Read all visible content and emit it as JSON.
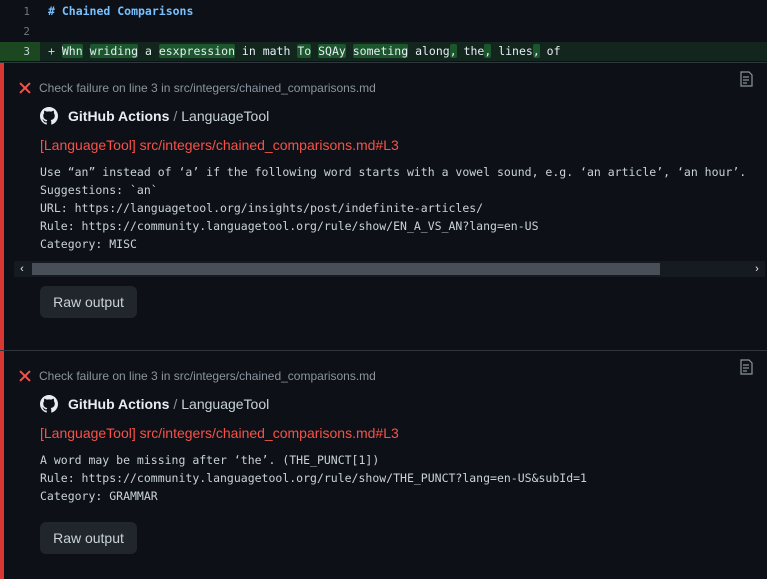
{
  "diff": {
    "lines": [
      {
        "num": "1",
        "text": "# Chained Comparisons"
      },
      {
        "num": "2",
        "text": ""
      },
      {
        "num": "3",
        "prefix": "+ ",
        "segments": [
          {
            "t": "Whn",
            "hl": true
          },
          {
            "t": " "
          },
          {
            "t": "wriding",
            "hl": true
          },
          {
            "t": " a "
          },
          {
            "t": "esxpression",
            "hl": true
          },
          {
            "t": " in math "
          },
          {
            "t": "To",
            "hl": true
          },
          {
            "t": " "
          },
          {
            "t": "SQAy",
            "hl": true
          },
          {
            "t": " "
          },
          {
            "t": "someting",
            "hl": true
          },
          {
            "t": " along"
          },
          {
            "t": ",",
            "hl": true
          },
          {
            "t": " the"
          },
          {
            "t": ",",
            "hl": true
          },
          {
            "t": " lines"
          },
          {
            "t": ",",
            "hl": true
          },
          {
            "t": " of"
          }
        ]
      }
    ]
  },
  "annotations": [
    {
      "header": "Check failure on line 3 in src/integers/chained_comparisons.md",
      "source_app": "GitHub Actions",
      "source_sep": "/",
      "source_tool": "LanguageTool",
      "title": "[LanguageTool] src/integers/chained_comparisons.md#L3",
      "message": "Use “an” instead of ‘a’ if the following word starts with a vowel sound, e.g. ‘an article’, ‘an hour’.\nSuggestions: `an`\nURL: https://languagetool.org/insights/post/indefinite-articles/\nRule: https://community.languagetool.org/rule/show/EN_A_VS_AN?lang=en-US\nCategory: MISC",
      "button": "Raw output"
    },
    {
      "header": "Check failure on line 3 in src/integers/chained_comparisons.md",
      "source_app": "GitHub Actions",
      "source_sep": "/",
      "source_tool": "LanguageTool",
      "title": "[LanguageTool] src/integers/chained_comparisons.md#L3",
      "message": "A word may be missing after ‘the’. (THE_PUNCT[1])\nRule: https://community.languagetool.org/rule/show/THE_PUNCT?lang=en-US&subId=1\nCategory: GRAMMAR",
      "button": "Raw output"
    }
  ],
  "scroll": {
    "left_arrow": "‹",
    "right_arrow": "›",
    "position": 0.87
  },
  "colors": {
    "error": "#f85149",
    "bar": "#da3633",
    "added_bg": "#12261e"
  }
}
